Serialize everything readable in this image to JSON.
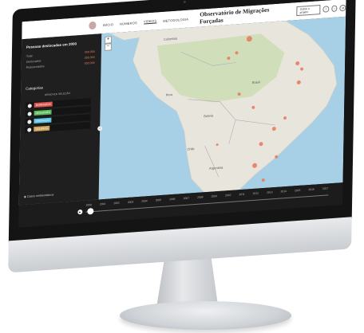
{
  "header": {
    "nav": [
      "INÍCIO",
      "NÚMEROS",
      "VIDEOS",
      "METODOLOGIA"
    ],
    "active_nav": 2,
    "title": "Observatório de Migrações Forçadas",
    "sobre_label": "Sobre o projeto",
    "social_icons": [
      "facebook-icon",
      "twitter-icon",
      "email-icon"
    ]
  },
  "sidebar": {
    "title": "Pessoas deslocadas em 2000",
    "rows": [
      {
        "label": "Total",
        "value": "000.000"
      },
      {
        "label": "Deslocados",
        "value": "000.000"
      },
      {
        "label": "Reassentados",
        "value": "000.000"
      }
    ],
    "categories_title": "Categorias",
    "categories_subtitle": "REMOVER SELEÇÃO",
    "categories": [
      {
        "label": "BARRAGENS",
        "color": "#d9534f"
      },
      {
        "label": "DESASTRES",
        "color": "#5cb85c"
      },
      {
        "label": "MINERAÇÃO",
        "color": "#5bc0de"
      },
      {
        "label": "VIOLÊNCIA",
        "color": "#c9a35a"
      }
    ],
    "cases_label": "Casos emblemáticos"
  },
  "map": {
    "labels": [
      {
        "text": "Colombia"
      },
      {
        "text": "Brasil"
      },
      {
        "text": "Peru"
      },
      {
        "text": "Bolivia"
      },
      {
        "text": "Chile"
      },
      {
        "text": "Argentina"
      }
    ],
    "marker_color": "#e8775a"
  },
  "timeline": {
    "years": [
      "2000",
      "2001",
      "2002",
      "2003",
      "2004",
      "2005",
      "2006",
      "2007",
      "2008",
      "2009",
      "2010",
      "2011",
      "2012",
      "2013",
      "2014",
      "2015",
      "2016",
      "2017"
    ]
  }
}
